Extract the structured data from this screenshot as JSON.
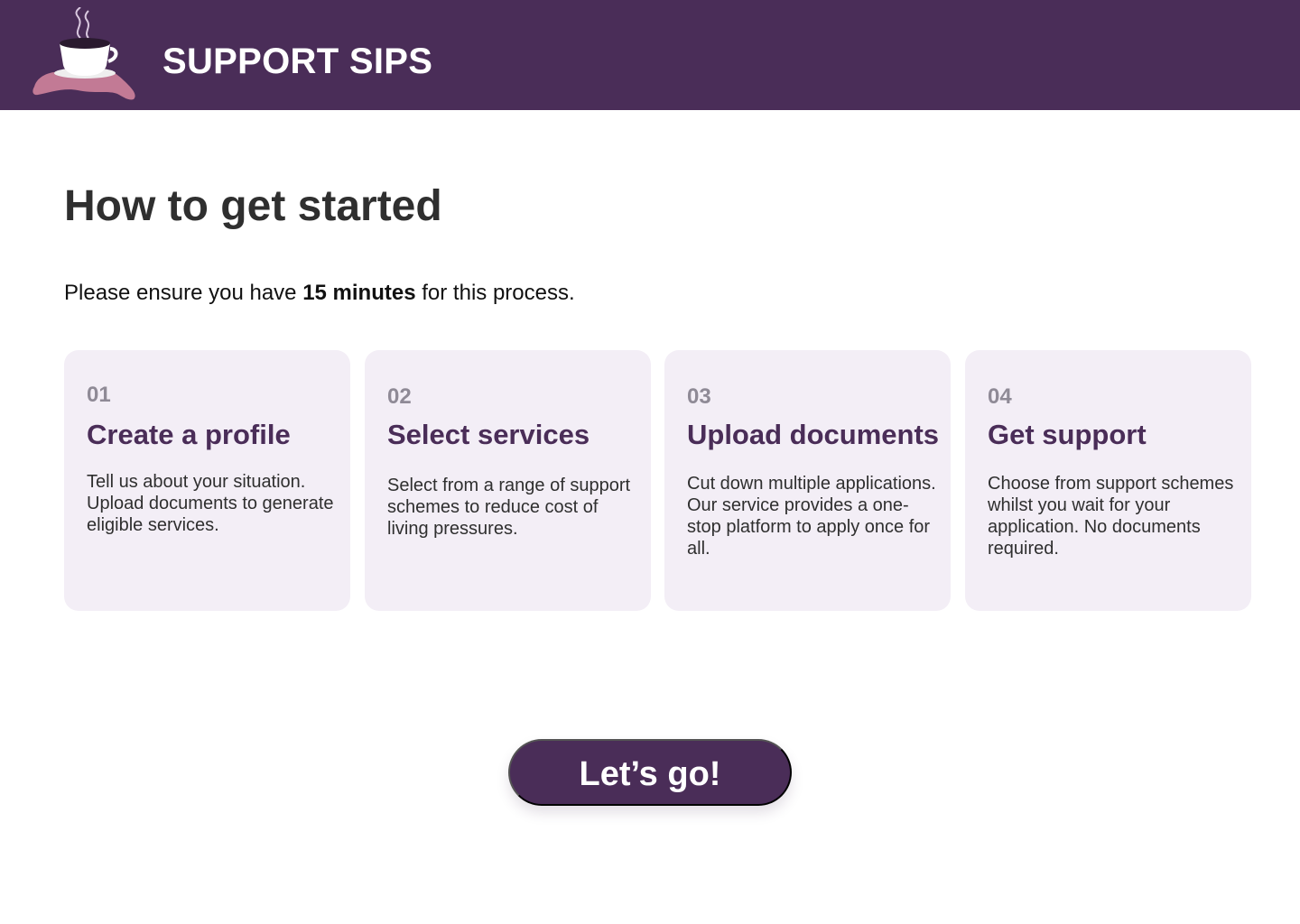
{
  "header": {
    "brand": "SUPPORT SIPS",
    "logo_icon": "coffee-cup-on-hand-icon",
    "background": "#4a2d58"
  },
  "main": {
    "title": "How to get started",
    "intro_before": "Please ensure you have ",
    "intro_bold": "15 minutes",
    "intro_after": " for this process."
  },
  "steps": [
    {
      "number": "01",
      "title": "Create a profile",
      "description": "Tell us about your situation. Upload documents to generate eligible services."
    },
    {
      "number": "02",
      "title": "Select services",
      "description": "Select from a range of support schemes to reduce cost of living pressures."
    },
    {
      "number": "03",
      "title": "Upload documents",
      "description": "Cut down multiple applications. Our service provides a one-stop platform to apply once for all."
    },
    {
      "number": "04",
      "title": "Get support",
      "description": "Choose from support schemes whilst you wait for your application. No documents required."
    }
  ],
  "cta": {
    "label": "Let’s go!"
  },
  "colors": {
    "accent": "#4a2d58",
    "card_bg": "#f3eef6",
    "step_number": "#8f8a96"
  }
}
